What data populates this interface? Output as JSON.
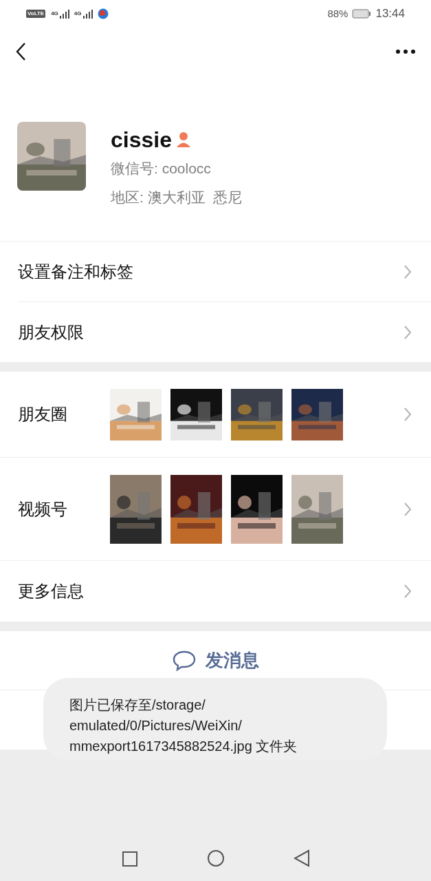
{
  "status_bar": {
    "network_badge": "VoLTE",
    "signal_1": "4G",
    "signal_2": "4G",
    "battery": "88%",
    "time": "13:44"
  },
  "profile": {
    "name": "cissie",
    "wechat_id": "微信号: coolocc",
    "region": "地区: 澳大利亚  悉尼"
  },
  "rows": [
    {
      "label": "设置备注和标签",
      "kind": "plain"
    },
    {
      "label": "朋友权限",
      "kind": "plain"
    }
  ],
  "media_rows": [
    {
      "label": "朋友圈"
    },
    {
      "label": "视频号"
    }
  ],
  "more_row": {
    "label": "更多信息"
  },
  "send_message": {
    "label": "发消息"
  },
  "toast": {
    "text": "图片已保存至/storage/\nemulated/0/Pictures/WeiXin/\nmmexport1617345882524.jpg 文件夹"
  }
}
